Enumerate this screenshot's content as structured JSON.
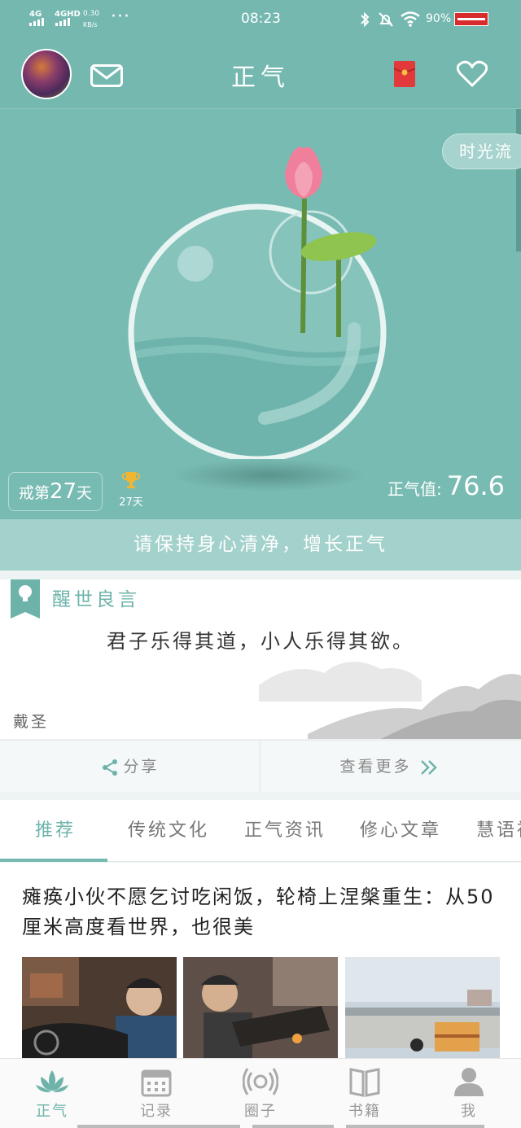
{
  "status_bar": {
    "network1": "4G",
    "network2": "4GHD",
    "speed_value": "0.30",
    "speed_unit": "KB/s",
    "time": "08:23",
    "battery": "90%"
  },
  "header": {
    "title": "正气"
  },
  "hero": {
    "time_flow_label": "时光流",
    "day_prefix": "戒第",
    "day_number": "27",
    "day_suffix": "天",
    "trophy_label": "27天",
    "zq_label": "正气值:",
    "zq_value": "76.6"
  },
  "motto": "请保持身心清净，增长正气",
  "quote_card": {
    "heading": "醒世良言",
    "text": "君子乐得其道，小人乐得其欲。",
    "author": "戴圣"
  },
  "actions": {
    "share": "分享",
    "more": "查看更多"
  },
  "tabs": [
    {
      "label": "推荐"
    },
    {
      "label": "传统文化"
    },
    {
      "label": "正气资讯"
    },
    {
      "label": "修心文章"
    },
    {
      "label": "慧语禅"
    }
  ],
  "article": {
    "title": "瘫痪小伙不愿乞讨吃闲饭，轮椅上涅槃重生：从50厘米高度看世界，也很美"
  },
  "bottom_nav": [
    {
      "label": "正气",
      "icon": "lotus-icon"
    },
    {
      "label": "记录",
      "icon": "calendar-icon"
    },
    {
      "label": "圈子",
      "icon": "broadcast-icon"
    },
    {
      "label": "书籍",
      "icon": "book-icon"
    },
    {
      "label": "我",
      "icon": "person-icon"
    }
  ],
  "colors": {
    "accent": "#74b8b0",
    "accent_text": "#6eb3aa",
    "hero_bg": "#78bbb2"
  }
}
